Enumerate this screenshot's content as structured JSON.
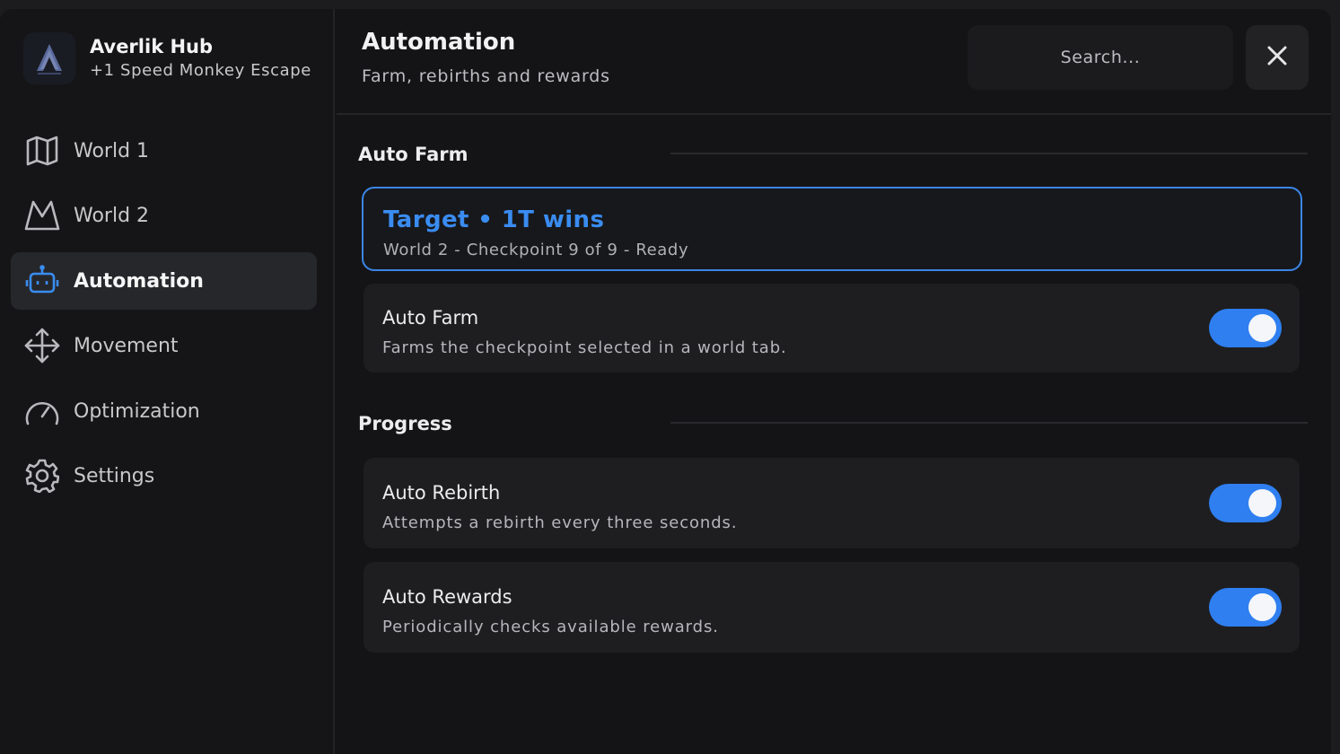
{
  "brand": {
    "title": "Averlik Hub",
    "subtitle": "+1 Speed Monkey Escape"
  },
  "sidebar": {
    "items": [
      {
        "label": "World 1",
        "icon": "map-icon"
      },
      {
        "label": "World 2",
        "icon": "mountain-icon"
      },
      {
        "label": "Automation",
        "icon": "robot-icon",
        "active": true
      },
      {
        "label": "Movement",
        "icon": "move-arrows-icon"
      },
      {
        "label": "Optimization",
        "icon": "gauge-icon"
      },
      {
        "label": "Settings",
        "icon": "gear-icon"
      }
    ]
  },
  "header": {
    "title": "Automation",
    "subtitle": "Farm, rebirths and rewards",
    "search_placeholder": "Search..."
  },
  "sections": {
    "auto_farm": {
      "title": "Auto Farm",
      "target": {
        "title": "Target • 1T wins",
        "subtitle": "World 2 - Checkpoint 9 of 9 - Ready"
      },
      "toggle": {
        "title": "Auto Farm",
        "description": "Farms the checkpoint selected in a world tab.",
        "enabled": true
      }
    },
    "progress": {
      "title": "Progress",
      "rebirth": {
        "title": "Auto Rebirth",
        "description": "Attempts a rebirth every three seconds.",
        "enabled": true
      },
      "rewards": {
        "title": "Auto Rewards",
        "description": "Periodically checks available rewards.",
        "enabled": true
      }
    }
  },
  "colors": {
    "accent": "#2f7ff0",
    "target_border": "#3b86e6",
    "background": "#141416",
    "card": "#1e1e21"
  }
}
